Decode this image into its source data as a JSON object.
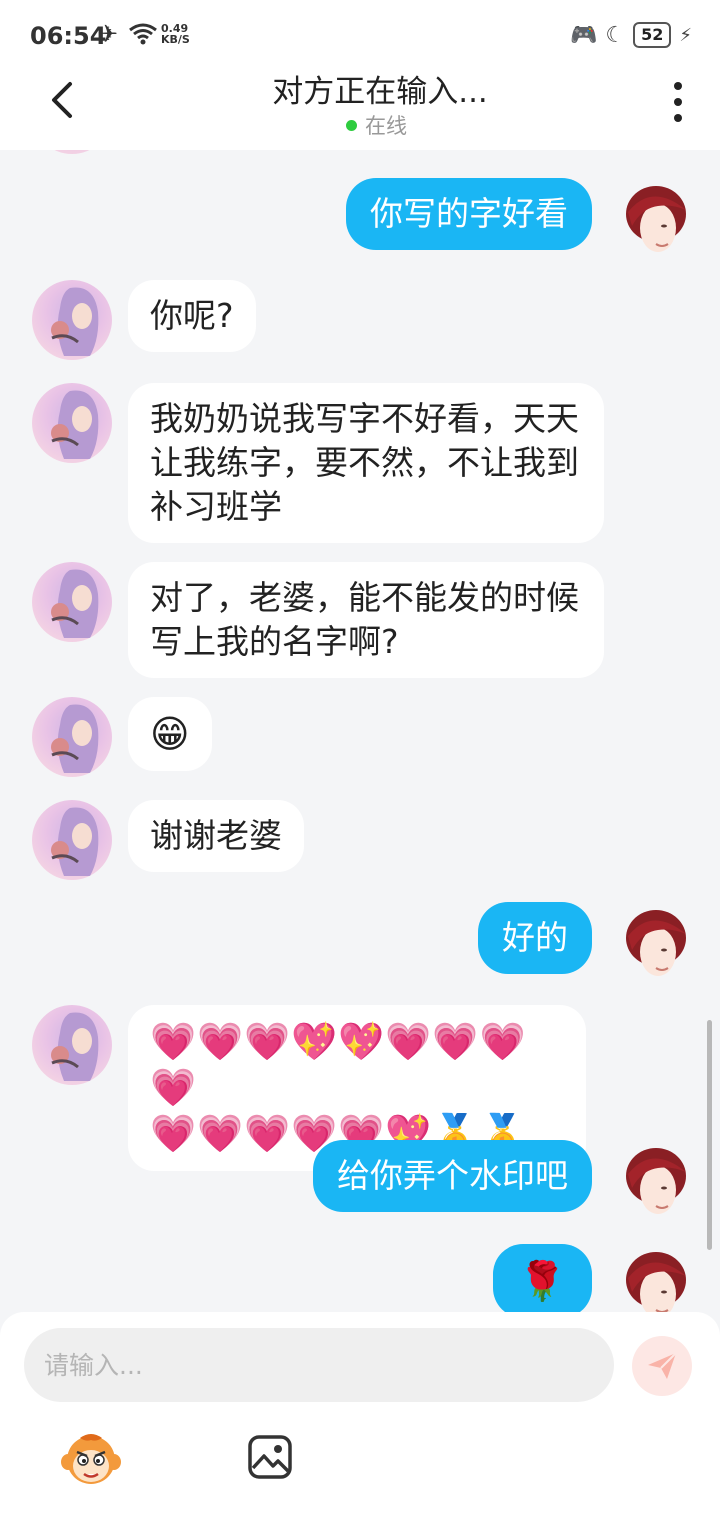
{
  "status_bar": {
    "time": "06:54",
    "net_speed_value": "0.49",
    "net_speed_unit": "KB/S",
    "battery": "52",
    "icons": [
      "airplane-icon",
      "wifi-icon",
      "game-controller-icon",
      "moon-icon",
      "charging-icon"
    ]
  },
  "header": {
    "title": "对方正在输入...",
    "status": "在线",
    "status_color": "#2ecc3f"
  },
  "messages": [
    {
      "side": "right",
      "text": "你写的字好看"
    },
    {
      "side": "left",
      "text": "你呢?"
    },
    {
      "side": "left",
      "text": "我奶奶说我写字不好看，天天让我练字，要不然，不让我到补习班学"
    },
    {
      "side": "left",
      "text": "对了，老婆，能不能发的时候写上我的名字啊?"
    },
    {
      "side": "left",
      "text": "😁"
    },
    {
      "side": "left",
      "text": "谢谢老婆"
    },
    {
      "side": "right",
      "text": "好的"
    },
    {
      "side": "left",
      "line1": "💗💗💗💖💖💗💗💗💗",
      "line2": "💗💗💗💗💗💖🥇🥇"
    },
    {
      "side": "right",
      "text": "给你弄个水印吧"
    },
    {
      "side": "right",
      "text": "🌹"
    }
  ],
  "input": {
    "placeholder": "请输入..."
  },
  "colors": {
    "bubble_sent": "#1ab6f4",
    "bubble_received": "#ffffff",
    "background": "#f4f5f7"
  },
  "toolbar": {
    "icons": [
      "monkey-sticker-icon",
      "image-icon"
    ]
  }
}
